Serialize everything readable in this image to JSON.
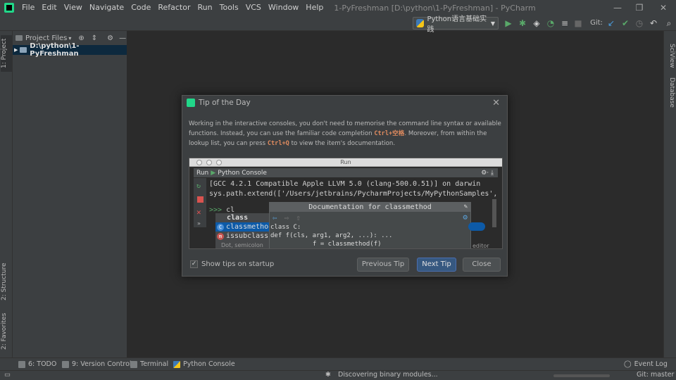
{
  "window": {
    "title": "1-PyFreshman [D:\\python\\1-PyFreshman] - PyCharm",
    "menu": [
      "File",
      "Edit",
      "View",
      "Navigate",
      "Code",
      "Refactor",
      "Run",
      "Tools",
      "VCS",
      "Window",
      "Help"
    ],
    "controls": {
      "minimize": "—",
      "restore": "❐",
      "close": "✕"
    }
  },
  "toolbar": {
    "run_config": "Python语言基础实践",
    "git_label": "Git:",
    "icons": [
      "run-icon",
      "debug-icon",
      "coverage-icon",
      "profile-icon",
      "concurrency-icon",
      "stop-icon",
      "git-update-icon",
      "git-commit-icon",
      "git-history-icon",
      "revert-icon",
      "search-icon"
    ]
  },
  "left_strip": {
    "project_tab": "1: Project",
    "structure_tab": "2: Structure",
    "favorites_tab": "2: Favorites"
  },
  "project_panel": {
    "view_selector": "Project Files",
    "root": "D:\\python\\1-PyFreshman"
  },
  "right_strip": {
    "sciview_tab": "SciView",
    "database_tab": "Database"
  },
  "bottom_bar": {
    "todo": "6: TODO",
    "version_control": "9: Version Control",
    "terminal": "Terminal",
    "python_console": "Python Console",
    "event_log": "Event Log"
  },
  "status_bar": {
    "message": "Discovering binary modules...",
    "git_branch": "Git: master"
  },
  "dialog": {
    "title": "Tip of the Day",
    "tip_parts": [
      "Working in the interactive consoles, you don't need to memorise the command line syntax or available functions. Instead, you can use the familiar code completion ",
      "Ctrl+空格",
      ". Moreover, from within the lookup list, you can press ",
      "Ctrl+Q",
      " to view the item's documentation."
    ],
    "image": {
      "window_title": "Run",
      "run_label": "Run",
      "console_tab": "Python Console",
      "console_lines": [
        "[GCC 4.2.1 Compatible Apple LLVM 5.0 (clang-500.0.51)] on darwin",
        "sys.path.extend(['/Users/jetbrains/PycharmProjects/MyPythonSamples', '/U"
      ],
      "prompt": ">>>",
      "typed": "cl",
      "completion": [
        {
          "icon": "",
          "text": "class"
        },
        {
          "icon": "C",
          "text": "classmethod"
        },
        {
          "icon": "m",
          "text": "issubclass"
        },
        {
          "icon": "",
          "text": "Dot, semicolon"
        }
      ],
      "doc_title": "Documentation for classmethod",
      "doc_lines": [
        "class C:",
        "def f(cls, arg1, arg2, ...): ...",
        "f = classmethod(f)"
      ],
      "editor_fragment": "editor"
    },
    "show_tips_label": "Show tips on startup",
    "show_tips_checked": true,
    "buttons": {
      "previous": "Previous Tip",
      "next": "Next Tip",
      "close": "Close"
    }
  }
}
